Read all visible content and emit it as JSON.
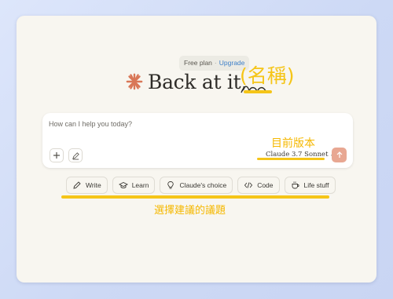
{
  "plan": {
    "label": "Free plan",
    "separator": "·",
    "upgrade": "Upgrade"
  },
  "greeting": {
    "text": "Back at it,",
    "accent_color": "#d97757"
  },
  "composer": {
    "placeholder": "How can I help you today?",
    "add_icon": "plus-icon",
    "style_icon": "pen-style-icon",
    "model": "Claude 3.7 Sonnet",
    "send_icon": "arrow-up-icon",
    "send_color": "#e8a792"
  },
  "suggestions": [
    {
      "label": "Write",
      "icon": "pencil-icon"
    },
    {
      "label": "Learn",
      "icon": "graduation-cap-icon"
    },
    {
      "label": "Claude's choice",
      "icon": "lightbulb-icon"
    },
    {
      "label": "Code",
      "icon": "code-icon"
    },
    {
      "label": "Life stuff",
      "icon": "coffee-cup-icon"
    }
  ],
  "annotations": {
    "name": "(名稱)",
    "version": "目前版本",
    "suggestions": "選擇建議的議題",
    "color": "#f5c518"
  }
}
